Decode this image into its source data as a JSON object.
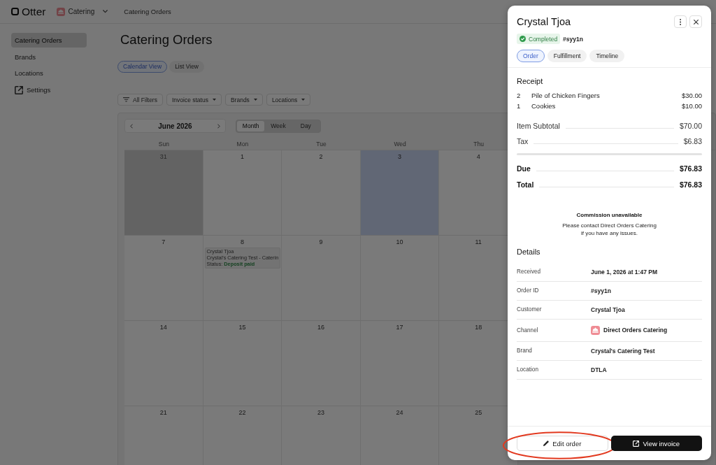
{
  "header": {
    "logo": "Otter",
    "brand_switcher": "Catering",
    "breadcrumb": "Catering Orders"
  },
  "sidebar": {
    "items": [
      {
        "label": "Catering Orders",
        "kind": "page",
        "selected": true
      },
      {
        "label": "Brands",
        "kind": "page",
        "selected": false
      },
      {
        "label": "Locations",
        "kind": "page",
        "selected": false
      },
      {
        "label": "Settings",
        "kind": "external",
        "selected": false
      }
    ]
  },
  "main": {
    "title": "Catering Orders",
    "view_tabs": [
      {
        "label": "Calendar View",
        "selected": true
      },
      {
        "label": "List View",
        "selected": false
      }
    ],
    "filters": [
      {
        "label": "All Filters",
        "kind": "all"
      },
      {
        "label": "Invoice status",
        "kind": "dropdown"
      },
      {
        "label": "Brands",
        "kind": "dropdown"
      },
      {
        "label": "Locations",
        "kind": "dropdown"
      }
    ],
    "calendar": {
      "month": "June 2026",
      "modes": [
        {
          "label": "Month",
          "selected": true
        },
        {
          "label": "Week",
          "selected": false
        },
        {
          "label": "Day",
          "selected": false
        }
      ],
      "weekdays": [
        "Sun",
        "Mon",
        "Tue",
        "Wed",
        "Thu"
      ],
      "weeks": [
        [
          {
            "day": "31",
            "in_month": false,
            "today": false
          },
          {
            "day": "1",
            "in_month": true,
            "today": false
          },
          {
            "day": "2",
            "in_month": true,
            "today": false
          },
          {
            "day": "3",
            "in_month": true,
            "today": true
          },
          {
            "day": "4",
            "in_month": true,
            "today": false
          }
        ],
        [
          {
            "day": "7",
            "in_month": true,
            "today": false
          },
          {
            "day": "8",
            "in_month": true,
            "today": false,
            "events": [
              {
                "customer": "Crystal Tjoa",
                "title": "Crystal's Catering Test - Caterin",
                "status": "Status: **Deposit paid**"
              }
            ]
          },
          {
            "day": "9",
            "in_month": true,
            "today": false
          },
          {
            "day": "10",
            "in_month": true,
            "today": false
          },
          {
            "day": "11",
            "in_month": true,
            "today": false
          }
        ],
        [
          {
            "day": "14",
            "in_month": true,
            "today": false
          },
          {
            "day": "15",
            "in_month": true,
            "today": false
          },
          {
            "day": "16",
            "in_month": true,
            "today": false
          },
          {
            "day": "17",
            "in_month": true,
            "today": false
          },
          {
            "day": "18",
            "in_month": true,
            "today": false
          }
        ],
        [
          {
            "day": "21",
            "in_month": true,
            "today": false
          },
          {
            "day": "22",
            "in_month": true,
            "today": false
          },
          {
            "day": "23",
            "in_month": true,
            "today": false
          },
          {
            "day": "24",
            "in_month": true,
            "today": false
          },
          {
            "day": "25",
            "in_month": true,
            "today": false
          }
        ]
      ]
    }
  },
  "drawer": {
    "title": "Crystal Tjoa",
    "status": "Completed",
    "order_number": "#syy1n",
    "tabs": [
      {
        "label": "Order",
        "selected": true
      },
      {
        "label": "Fulfillment",
        "selected": false
      },
      {
        "label": "Timeline",
        "selected": false
      }
    ],
    "receipt": {
      "heading": "Receipt",
      "items": [
        {
          "quantity": "2",
          "name": "Pile of Chicken Fingers",
          "price": "$30.00"
        },
        {
          "quantity": "1",
          "name": "Cookies",
          "price": "$10.00"
        }
      ],
      "summary": [
        {
          "label": "Item Subtotal",
          "amount": "$70.00"
        },
        {
          "label": "Tax",
          "amount": "$6.83"
        }
      ],
      "totals": [
        {
          "label": "Due",
          "amount": "$76.83"
        },
        {
          "label": "Total",
          "amount": "$76.83"
        }
      ]
    },
    "commission": {
      "title": "Commission unavailable",
      "message": "Please contact Direct Orders Catering\nif you have any issues."
    },
    "details": {
      "heading": "Details",
      "rows": [
        {
          "label": "Received",
          "value": "June 1, 2026 at 1:47 PM",
          "kind": "text"
        },
        {
          "label": "Order ID",
          "value": "#syy1n",
          "kind": "text"
        },
        {
          "label": "Customer",
          "value": "Crystal Tjoa",
          "kind": "text"
        },
        {
          "label": "Channel",
          "value": "Direct Orders Catering",
          "kind": "channel"
        },
        {
          "label": "Brand",
          "value": "Crystal's Catering Test",
          "kind": "text"
        },
        {
          "label": "Location",
          "value": "DTLA",
          "kind": "text"
        }
      ]
    },
    "actions": [
      {
        "label": "Edit order",
        "kind": "edit",
        "highlighted": true
      },
      {
        "label": "View invoice",
        "kind": "open",
        "highlighted": false
      }
    ]
  }
}
